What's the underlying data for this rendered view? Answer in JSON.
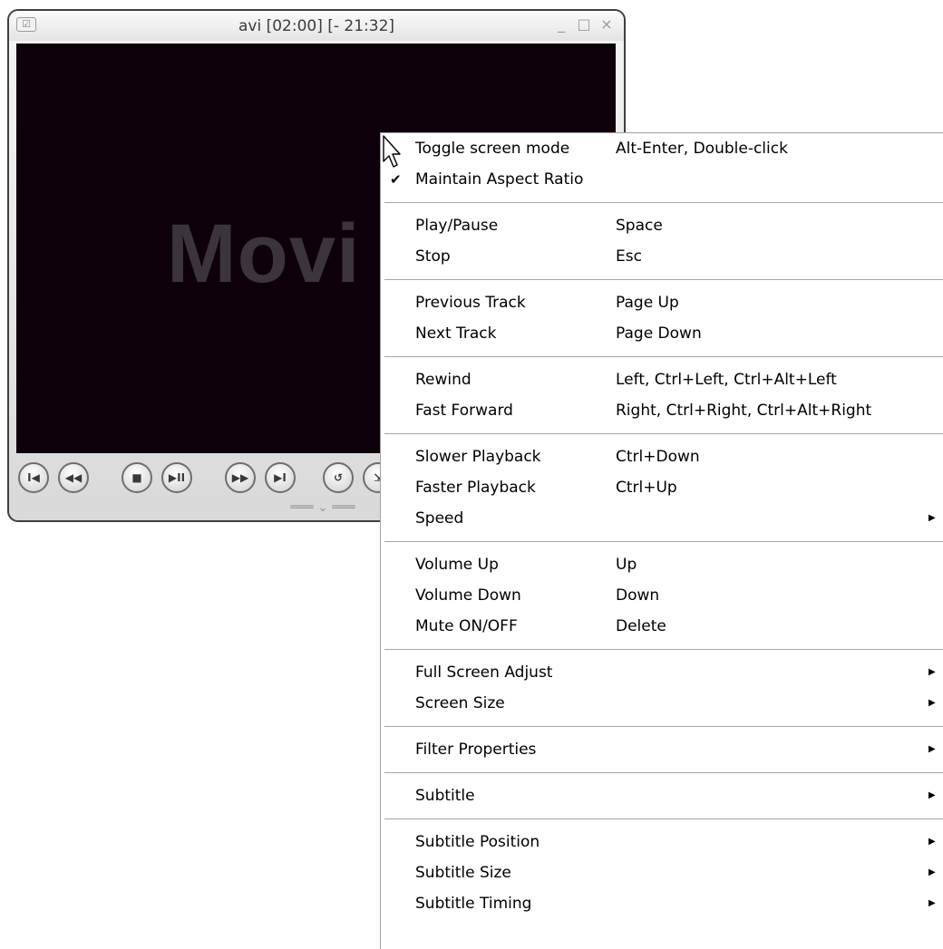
{
  "window": {
    "title": "avi [02:00] [- 21:32]",
    "system_icon_glyph": "☑",
    "minimize_glyph": "_",
    "maximize_glyph": "□",
    "close_glyph": "×"
  },
  "video": {
    "overlay_text": "Movi"
  },
  "controls": {
    "prev_glyph": "I◀",
    "rewind_glyph": "◀◀",
    "stop_glyph": "■",
    "playpause_glyph": "▶II",
    "forward_glyph": "▶▶",
    "next_glyph": "▶I",
    "repeat_glyph": "↺",
    "extra_glyph": "⇲",
    "grip_glyph": "═══ ⌄ ═══"
  },
  "menu": {
    "groups": [
      [
        {
          "label": "Toggle screen mode",
          "shortcut": "Alt-Enter, Double-click",
          "checked": false,
          "submenu": false
        },
        {
          "label": "Maintain Aspect Ratio",
          "shortcut": "",
          "checked": true,
          "submenu": false
        }
      ],
      [
        {
          "label": "Play/Pause",
          "shortcut": "Space",
          "checked": false,
          "submenu": false
        },
        {
          "label": "Stop",
          "shortcut": "Esc",
          "checked": false,
          "submenu": false
        }
      ],
      [
        {
          "label": "Previous Track",
          "shortcut": "Page Up",
          "checked": false,
          "submenu": false
        },
        {
          "label": "Next Track",
          "shortcut": "Page Down",
          "checked": false,
          "submenu": false
        }
      ],
      [
        {
          "label": "Rewind",
          "shortcut": "Left, Ctrl+Left, Ctrl+Alt+Left",
          "checked": false,
          "submenu": false
        },
        {
          "label": "Fast Forward",
          "shortcut": "Right, Ctrl+Right, Ctrl+Alt+Right",
          "checked": false,
          "submenu": false
        }
      ],
      [
        {
          "label": "Slower Playback",
          "shortcut": "Ctrl+Down",
          "checked": false,
          "submenu": false
        },
        {
          "label": "Faster Playback",
          "shortcut": "Ctrl+Up",
          "checked": false,
          "submenu": false
        },
        {
          "label": "Speed",
          "shortcut": "",
          "checked": false,
          "submenu": true
        }
      ],
      [
        {
          "label": "Volume Up",
          "shortcut": "Up",
          "checked": false,
          "submenu": false
        },
        {
          "label": "Volume Down",
          "shortcut": "Down",
          "checked": false,
          "submenu": false
        },
        {
          "label": "Mute ON/OFF",
          "shortcut": "Delete",
          "checked": false,
          "submenu": false
        }
      ],
      [
        {
          "label": "Full Screen Adjust",
          "shortcut": "",
          "checked": false,
          "submenu": true
        },
        {
          "label": "Screen Size",
          "shortcut": "",
          "checked": false,
          "submenu": true
        }
      ],
      [
        {
          "label": "Filter Properties",
          "shortcut": "",
          "checked": false,
          "submenu": true
        }
      ],
      [
        {
          "label": "Subtitle",
          "shortcut": "",
          "checked": false,
          "submenu": true
        }
      ],
      [
        {
          "label": "Subtitle Position",
          "shortcut": "",
          "checked": false,
          "submenu": true
        },
        {
          "label": "Subtitle Size",
          "shortcut": "",
          "checked": false,
          "submenu": true
        },
        {
          "label": "Subtitle Timing",
          "shortcut": "",
          "checked": false,
          "submenu": true
        }
      ]
    ],
    "check_glyph": "✔",
    "arrow_glyph": "▶"
  }
}
